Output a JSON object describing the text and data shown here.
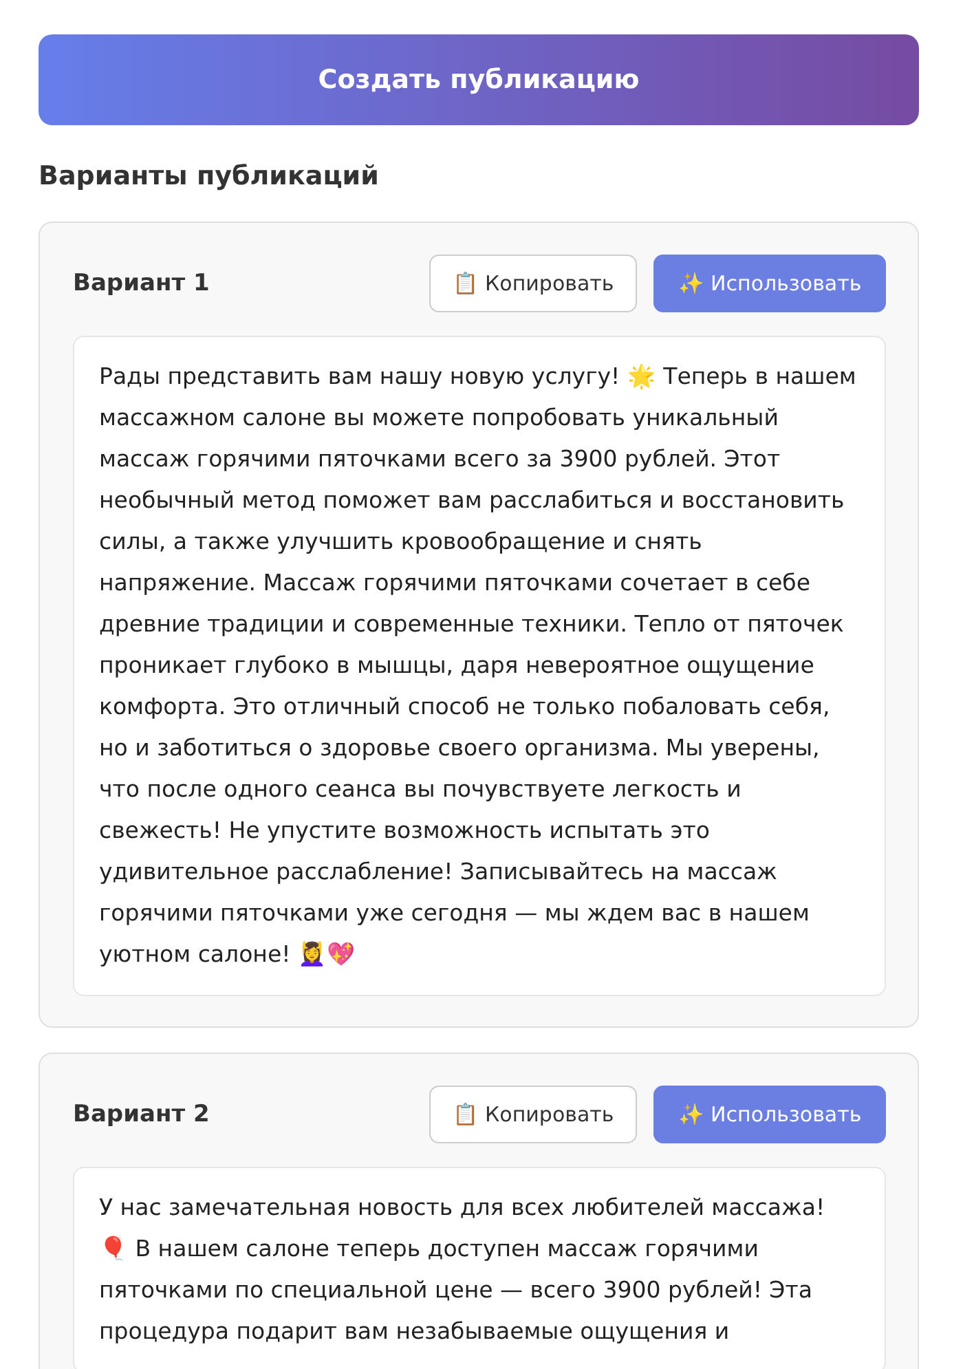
{
  "create_button": {
    "label": "Создать публикацию"
  },
  "section_title": "Варианты публикаций",
  "variants": [
    {
      "title": "Вариант 1",
      "copy_label": "📋 Копировать",
      "use_label": "✨ Использовать",
      "text": "Рады представить вам нашу новую услугу! 🌟 Теперь в нашем массажном салоне вы можете попробовать уникальный массаж горячими пяточками всего за 3900 рублей. Этот необычный метод поможет вам расслабиться и восстановить силы, а также улучшить кровообращение и снять напряжение. Массаж горячими пяточками сочетает в себе древние традиции и современные техники. Тепло от пяточек проникает глубоко в мышцы, даря невероятное ощущение комфорта. Это отличный способ не только побаловать себя, но и заботиться о здоровье своего организма. Мы уверены, что после одного сеанса вы почувствуете легкость и свежесть! Не упустите возможность испытать это удивительное расслабление! Записывайтесь на массаж горячими пяточками уже сегодня — мы ждем вас в нашем уютном салоне! 💆‍♀️💖"
    },
    {
      "title": "Вариант 2",
      "copy_label": "📋 Копировать",
      "use_label": "✨ Использовать",
      "text": "У нас замечательная новость для всех любителей массажа! 🎈 В нашем салоне теперь доступен массаж горячими пяточками по специальной цене — всего 3900 рублей! Эта процедура подарит вам незабываемые ощущения и"
    }
  ]
}
